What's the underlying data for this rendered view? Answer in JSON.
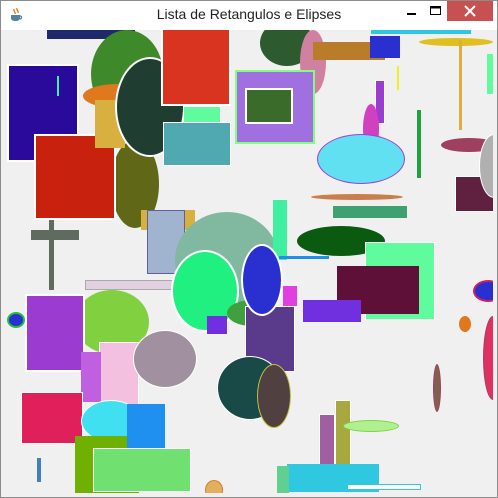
{
  "window": {
    "title": "Lista de Retangulos e Elipses",
    "controls": [
      "minimize",
      "maximize",
      "close"
    ],
    "icon": "java-cup-icon"
  },
  "canvas": {
    "background": "#f0f0f0",
    "rectangles": [
      {
        "fill": "#1f2a6b",
        "stroke": "#1f2a6b"
      },
      {
        "fill": "#2a0a9a",
        "stroke": "#ffffff"
      },
      {
        "fill": "#c8220f",
        "stroke": "#ffffff"
      },
      {
        "fill": "#d83420",
        "stroke": "#ffffff"
      },
      {
        "fill": "#a070e0",
        "stroke": "#80ff80"
      },
      {
        "fill": "#3a6b2a",
        "stroke": "#ffffff"
      },
      {
        "fill": "#b87c2a",
        "stroke": "#b87c2a"
      },
      {
        "fill": "#2a30d0",
        "stroke": "#2a30d0"
      },
      {
        "fill": "#50a8b0",
        "stroke": "#ffffff"
      },
      {
        "fill": "#5e6b5e",
        "stroke": "#5e6b5e"
      },
      {
        "fill": "#a0b4d0",
        "stroke": "#6060a0"
      },
      {
        "fill": "#d8b040",
        "stroke": "#d8b040"
      },
      {
        "fill": "#40f0a0",
        "stroke": "#40f0a0"
      },
      {
        "fill": "#5ffb9c",
        "stroke": "#ffffff"
      },
      {
        "fill": "#5e1038",
        "stroke": "#5e1038"
      },
      {
        "fill": "#7030e0",
        "stroke": "#7030e0"
      },
      {
        "fill": "#9b3bd0",
        "stroke": "#ffffff"
      },
      {
        "fill": "#f4c0e0",
        "stroke": "#ffffff"
      },
      {
        "fill": "#e0205a",
        "stroke": "#ffffff"
      },
      {
        "fill": "#2090f0",
        "stroke": "#2090f0"
      },
      {
        "fill": "#70b000",
        "stroke": "#70b000"
      },
      {
        "fill": "#70e070",
        "stroke": "#ffffff"
      },
      {
        "fill": "#30c8e0",
        "stroke": "#30c8e0"
      },
      {
        "fill": "#5a3a8a",
        "stroke": "#ffffff"
      },
      {
        "fill": "#a8a840",
        "stroke": "#ffffff"
      },
      {
        "fill": "#602040",
        "stroke": "#ffffff"
      },
      {
        "fill": "#40a070",
        "stroke": "#40a070"
      },
      {
        "fill": "#ffffff",
        "stroke": "#aaaaaa"
      }
    ],
    "ellipses": [
      {
        "fill": "#3e8a2a",
        "stroke": "#3e8a2a"
      },
      {
        "fill": "#1f3d30",
        "stroke": "#ffffff"
      },
      {
        "fill": "#2e5a30",
        "stroke": "#2e5a30"
      },
      {
        "fill": "#d080a0",
        "stroke": "#d080a0"
      },
      {
        "fill": "#60e0f0",
        "stroke": "#a040d0"
      },
      {
        "fill": "#0a5a10",
        "stroke": "#0a5a10"
      },
      {
        "fill": "#80b8a0",
        "stroke": "#80b8a0"
      },
      {
        "fill": "#20f080",
        "stroke": "#ffffff"
      },
      {
        "fill": "#2a30d0",
        "stroke": "#ffffff"
      },
      {
        "fill": "#a090a0",
        "stroke": "#ffffff"
      },
      {
        "fill": "#1a4a48",
        "stroke": "#ffffff"
      },
      {
        "fill": "#504040",
        "stroke": "#c0c040"
      },
      {
        "fill": "#40e0f0",
        "stroke": "#ffffff"
      },
      {
        "fill": "#80d040",
        "stroke": "#80d040"
      },
      {
        "fill": "#d040c0",
        "stroke": "#d040c0"
      },
      {
        "fill": "#606818",
        "stroke": "#606818"
      },
      {
        "fill": "#e07820",
        "stroke": "#e07820"
      },
      {
        "fill": "#a04060",
        "stroke": "#a04060"
      }
    ]
  }
}
